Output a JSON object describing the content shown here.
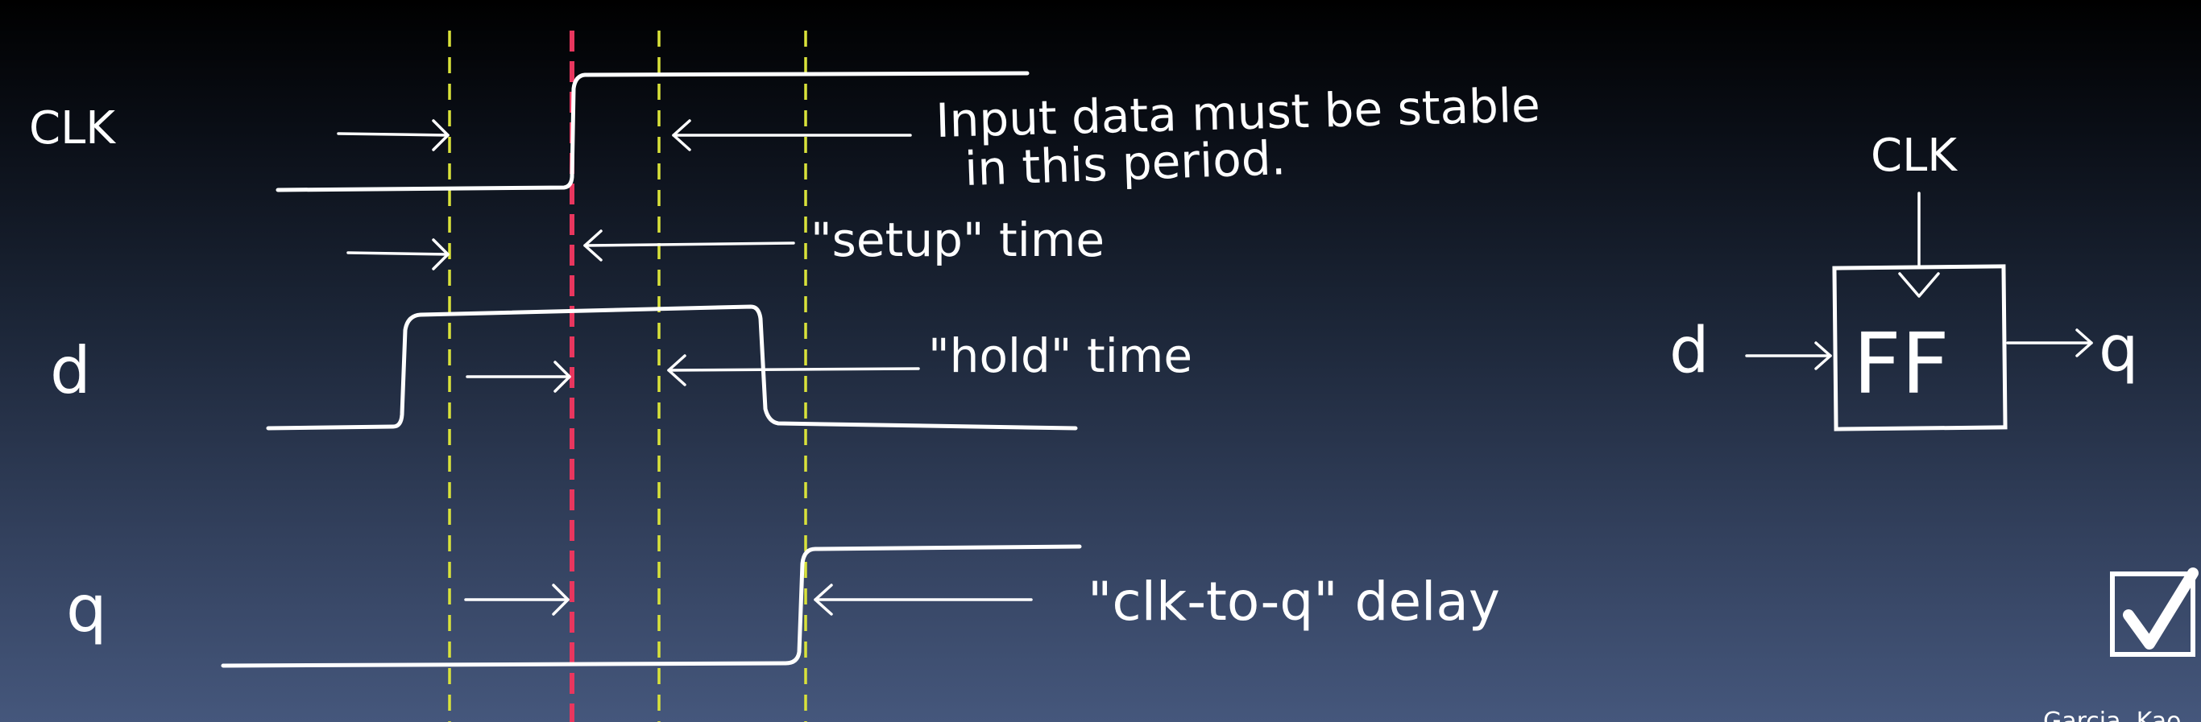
{
  "signals": {
    "clk": "CLK",
    "d": "d",
    "q": "q"
  },
  "annotations": {
    "stable_line1": "Input data must be stable",
    "stable_line2": "in this period.",
    "setup": "\"setup\" time",
    "hold": "\"hold\" time",
    "clk_to_q": "\"clk-to-q\" delay"
  },
  "flipflop": {
    "clk": "CLK",
    "label": "FF",
    "input": "d",
    "output": "q"
  },
  "footer": {
    "credit": "Garcia, Kao"
  },
  "colors": {
    "background_top": "#000000",
    "background_bottom": "#45577c",
    "guide_yellow": "#d9e23a",
    "guide_red": "#e8365e",
    "ink": "#ffffff"
  },
  "icons": {
    "corner": "checkbox-checked-icon"
  }
}
